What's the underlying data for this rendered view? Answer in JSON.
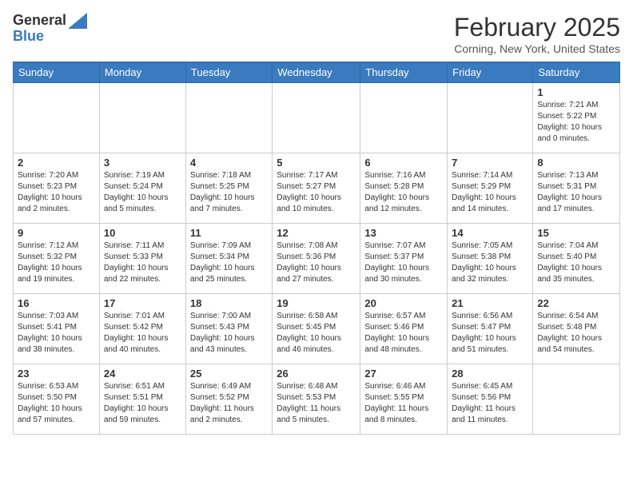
{
  "header": {
    "logo_general": "General",
    "logo_blue": "Blue",
    "month_year": "February 2025",
    "location": "Corning, New York, United States"
  },
  "days_of_week": [
    "Sunday",
    "Monday",
    "Tuesday",
    "Wednesday",
    "Thursday",
    "Friday",
    "Saturday"
  ],
  "weeks": [
    [
      {
        "day": "",
        "info": ""
      },
      {
        "day": "",
        "info": ""
      },
      {
        "day": "",
        "info": ""
      },
      {
        "day": "",
        "info": ""
      },
      {
        "day": "",
        "info": ""
      },
      {
        "day": "",
        "info": ""
      },
      {
        "day": "1",
        "info": "Sunrise: 7:21 AM\nSunset: 5:22 PM\nDaylight: 10 hours\nand 0 minutes."
      }
    ],
    [
      {
        "day": "2",
        "info": "Sunrise: 7:20 AM\nSunset: 5:23 PM\nDaylight: 10 hours\nand 2 minutes."
      },
      {
        "day": "3",
        "info": "Sunrise: 7:19 AM\nSunset: 5:24 PM\nDaylight: 10 hours\nand 5 minutes."
      },
      {
        "day": "4",
        "info": "Sunrise: 7:18 AM\nSunset: 5:25 PM\nDaylight: 10 hours\nand 7 minutes."
      },
      {
        "day": "5",
        "info": "Sunrise: 7:17 AM\nSunset: 5:27 PM\nDaylight: 10 hours\nand 10 minutes."
      },
      {
        "day": "6",
        "info": "Sunrise: 7:16 AM\nSunset: 5:28 PM\nDaylight: 10 hours\nand 12 minutes."
      },
      {
        "day": "7",
        "info": "Sunrise: 7:14 AM\nSunset: 5:29 PM\nDaylight: 10 hours\nand 14 minutes."
      },
      {
        "day": "8",
        "info": "Sunrise: 7:13 AM\nSunset: 5:31 PM\nDaylight: 10 hours\nand 17 minutes."
      }
    ],
    [
      {
        "day": "9",
        "info": "Sunrise: 7:12 AM\nSunset: 5:32 PM\nDaylight: 10 hours\nand 19 minutes."
      },
      {
        "day": "10",
        "info": "Sunrise: 7:11 AM\nSunset: 5:33 PM\nDaylight: 10 hours\nand 22 minutes."
      },
      {
        "day": "11",
        "info": "Sunrise: 7:09 AM\nSunset: 5:34 PM\nDaylight: 10 hours\nand 25 minutes."
      },
      {
        "day": "12",
        "info": "Sunrise: 7:08 AM\nSunset: 5:36 PM\nDaylight: 10 hours\nand 27 minutes."
      },
      {
        "day": "13",
        "info": "Sunrise: 7:07 AM\nSunset: 5:37 PM\nDaylight: 10 hours\nand 30 minutes."
      },
      {
        "day": "14",
        "info": "Sunrise: 7:05 AM\nSunset: 5:38 PM\nDaylight: 10 hours\nand 32 minutes."
      },
      {
        "day": "15",
        "info": "Sunrise: 7:04 AM\nSunset: 5:40 PM\nDaylight: 10 hours\nand 35 minutes."
      }
    ],
    [
      {
        "day": "16",
        "info": "Sunrise: 7:03 AM\nSunset: 5:41 PM\nDaylight: 10 hours\nand 38 minutes."
      },
      {
        "day": "17",
        "info": "Sunrise: 7:01 AM\nSunset: 5:42 PM\nDaylight: 10 hours\nand 40 minutes."
      },
      {
        "day": "18",
        "info": "Sunrise: 7:00 AM\nSunset: 5:43 PM\nDaylight: 10 hours\nand 43 minutes."
      },
      {
        "day": "19",
        "info": "Sunrise: 6:58 AM\nSunset: 5:45 PM\nDaylight: 10 hours\nand 46 minutes."
      },
      {
        "day": "20",
        "info": "Sunrise: 6:57 AM\nSunset: 5:46 PM\nDaylight: 10 hours\nand 48 minutes."
      },
      {
        "day": "21",
        "info": "Sunrise: 6:56 AM\nSunset: 5:47 PM\nDaylight: 10 hours\nand 51 minutes."
      },
      {
        "day": "22",
        "info": "Sunrise: 6:54 AM\nSunset: 5:48 PM\nDaylight: 10 hours\nand 54 minutes."
      }
    ],
    [
      {
        "day": "23",
        "info": "Sunrise: 6:53 AM\nSunset: 5:50 PM\nDaylight: 10 hours\nand 57 minutes."
      },
      {
        "day": "24",
        "info": "Sunrise: 6:51 AM\nSunset: 5:51 PM\nDaylight: 10 hours\nand 59 minutes."
      },
      {
        "day": "25",
        "info": "Sunrise: 6:49 AM\nSunset: 5:52 PM\nDaylight: 11 hours\nand 2 minutes."
      },
      {
        "day": "26",
        "info": "Sunrise: 6:48 AM\nSunset: 5:53 PM\nDaylight: 11 hours\nand 5 minutes."
      },
      {
        "day": "27",
        "info": "Sunrise: 6:46 AM\nSunset: 5:55 PM\nDaylight: 11 hours\nand 8 minutes."
      },
      {
        "day": "28",
        "info": "Sunrise: 6:45 AM\nSunset: 5:56 PM\nDaylight: 11 hours\nand 11 minutes."
      },
      {
        "day": "",
        "info": ""
      }
    ]
  ]
}
